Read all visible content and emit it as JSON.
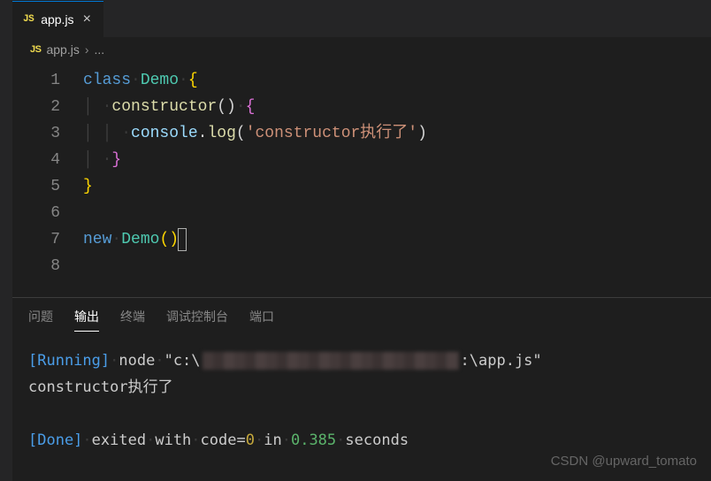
{
  "tab": {
    "badge": "JS",
    "filename": "app.js"
  },
  "breadcrumb": {
    "badge": "JS",
    "file": "app.js",
    "separator": "›",
    "rest": "..."
  },
  "editor": {
    "lines": [
      {
        "n": "1",
        "tokens": [
          [
            "kw",
            "class"
          ],
          [
            "ws",
            "·"
          ],
          [
            "cls",
            "Demo"
          ],
          [
            "ws",
            "·"
          ],
          [
            "brace",
            "{"
          ]
        ]
      },
      {
        "n": "2",
        "tokens": [
          [
            "guide",
            "│ "
          ],
          [
            "ws",
            "·"
          ],
          [
            "fn",
            "constructor"
          ],
          [
            "dot",
            "()"
          ],
          [
            "ws",
            "·"
          ],
          [
            "brace2",
            "{"
          ]
        ]
      },
      {
        "n": "3",
        "tokens": [
          [
            "guide",
            "│ │ "
          ],
          [
            "ws",
            "·"
          ],
          [
            "obj",
            "console"
          ],
          [
            "dot",
            "."
          ],
          [
            "fn",
            "log"
          ],
          [
            "dot",
            "("
          ],
          [
            "str",
            "'constructor执行了'"
          ],
          [
            "dot",
            ")"
          ]
        ]
      },
      {
        "n": "4",
        "tokens": [
          [
            "guide",
            "│ "
          ],
          [
            "ws",
            "·"
          ],
          [
            "brace2",
            "}"
          ]
        ]
      },
      {
        "n": "5",
        "tokens": [
          [
            "brace",
            "}"
          ]
        ]
      },
      {
        "n": "6",
        "tokens": []
      },
      {
        "n": "7",
        "tokens": [
          [
            "kw",
            "new"
          ],
          [
            "ws",
            "·"
          ],
          [
            "cls",
            "Demo"
          ],
          [
            "brace",
            "()"
          ]
        ],
        "cursor": true
      },
      {
        "n": "8",
        "tokens": []
      }
    ]
  },
  "panel": {
    "tabs": [
      {
        "label": "问题",
        "active": false
      },
      {
        "label": "输出",
        "active": true
      },
      {
        "label": "终端",
        "active": false
      },
      {
        "label": "调试控制台",
        "active": false
      },
      {
        "label": "端口",
        "active": false
      }
    ],
    "output": {
      "line1_prefix": "[Running]",
      "line1_cmd_a": "node",
      "line1_cmd_b": "\"c:\\",
      "line1_cmd_c": ":\\app.js\"",
      "line2": "constructor执行了",
      "line3_prefix": "[Done]",
      "line3_a": "exited",
      "line3_b": "with",
      "line3_c": "code=",
      "line3_code": "0",
      "line3_d": "in",
      "line3_time": "0.385",
      "line3_e": "seconds"
    }
  },
  "watermark": "CSDN @upward_tomato"
}
